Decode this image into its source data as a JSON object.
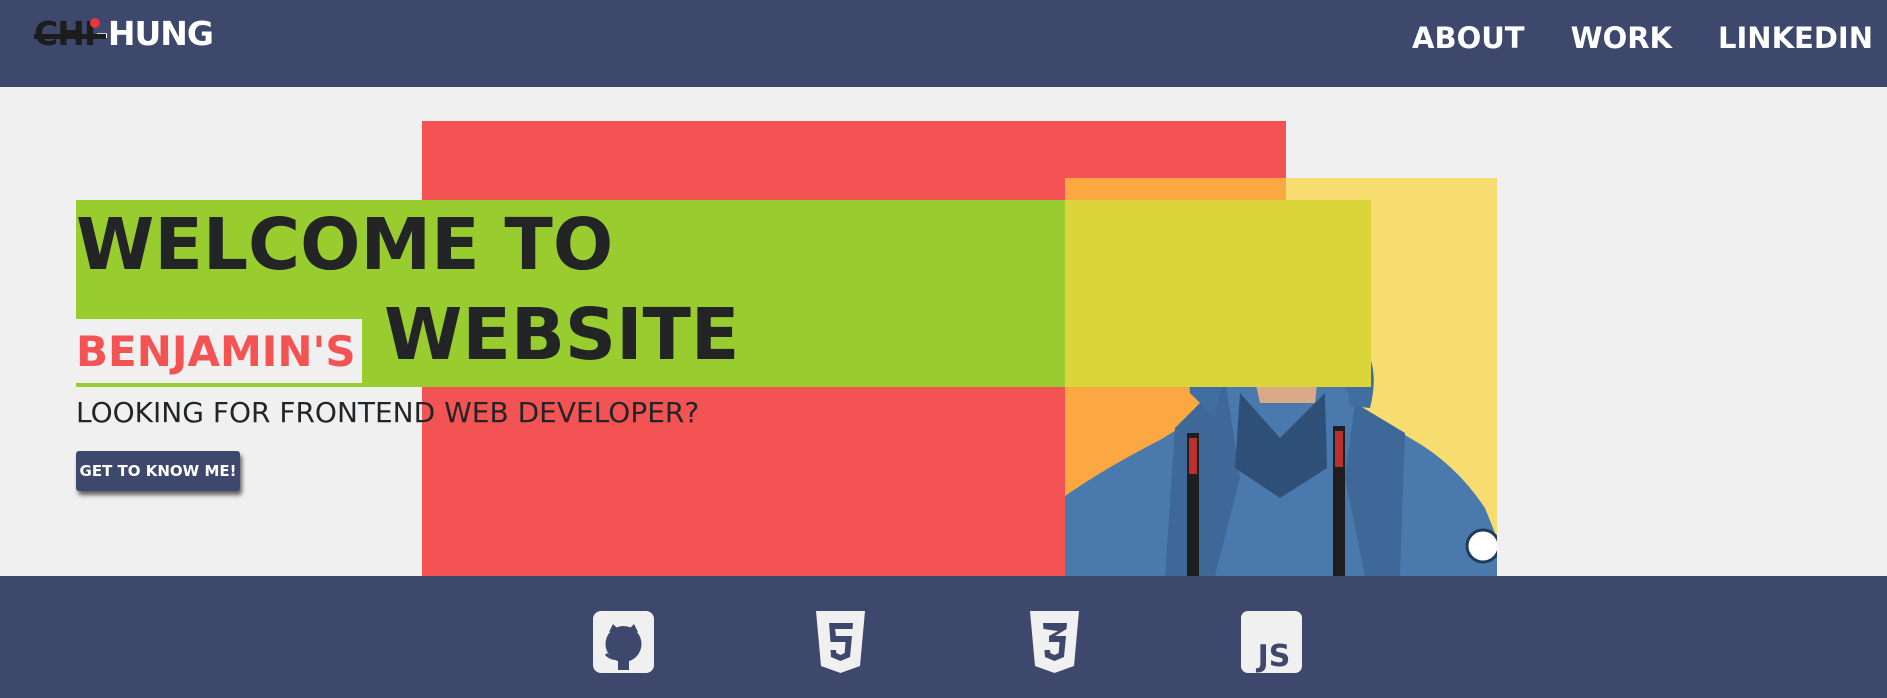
{
  "brand": {
    "logo_text_a": "CHI",
    "logo_text_b": "-HUNG"
  },
  "nav": {
    "links": [
      {
        "label": "ABOUT"
      },
      {
        "label": "WORK"
      },
      {
        "label": "LINKEDIN"
      }
    ]
  },
  "hero": {
    "title_line1": "WELCOME TO",
    "name": "BENJAMIN'S",
    "title_line2": "WEBSITE",
    "subtitle": "LOOKING FOR FRONTEND WEB DEVELOPER?",
    "cta_label": "GET TO KNOW ME!"
  },
  "footer": {
    "icons": [
      {
        "name": "github-icon"
      },
      {
        "name": "html5-icon"
      },
      {
        "name": "css3-icon"
      },
      {
        "name": "js-icon",
        "label": "JS"
      }
    ]
  },
  "colors": {
    "navy": "#3e486c",
    "red": "#f45353",
    "green": "#98cc2f",
    "yellow": "#f7dc6f",
    "orange": "#fba842",
    "text_dark": "#222426"
  }
}
